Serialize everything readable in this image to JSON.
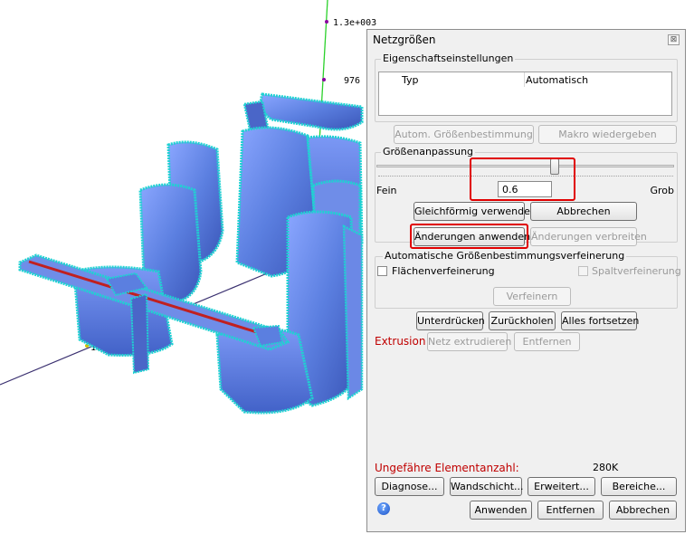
{
  "viewport": {
    "axis_labels": [
      "1.3e+003",
      "976",
      "1.2e+003"
    ]
  },
  "panel": {
    "title": "Netzgrößen",
    "close_glyph": "⊠",
    "property_settings": {
      "group_label": "Eigenschaftseinstellungen",
      "table_header_type": "Typ",
      "table_header_value": "Automatisch",
      "auto_size_button": "Autom. Größenbestimmung",
      "macro_button": "Makro wiedergeben"
    },
    "size_adjust": {
      "group_label": "Größenanpassung",
      "slider_level": 0.6,
      "label_fine": "Fein",
      "label_coarse": "Grob",
      "value": "0.6",
      "uniform_button": "Gleichförmig verwenden",
      "cancel_button": "Abbrechen",
      "apply_changes_button": "Änderungen anwenden",
      "spread_changes_button": "Änderungen verbreiten"
    },
    "auto_refine": {
      "group_label": "Automatische Größenbestimmungsverfeinerung",
      "surface_refine": "Flächenverfeinerung",
      "gap_refine": "Spaltverfeinerung",
      "refine_button": "Verfeinern"
    },
    "actions": {
      "suppress": "Unterdrücken",
      "reset": "Zurückholen",
      "continue_all": "Alles fortsetzen"
    },
    "extrusion": {
      "label": "Extrusion",
      "extrude_button": "Netz extrudieren",
      "remove_button": "Entfernen"
    },
    "element_count": {
      "label": "Ungefähre Elementanzahl:",
      "value": "280K"
    },
    "bottom_buttons": {
      "diagnose": "Diagnose...",
      "wall_layer": "Wandschicht...",
      "advanced": "Erweitert...",
      "areas": "Bereiche...",
      "apply": "Anwenden",
      "remove": "Entfernen",
      "cancel": "Abbrechen"
    },
    "help_glyph": "?",
    "colors": {
      "accent_red": "#e00000",
      "label_red": "#c00000",
      "seat_blue": "#5b7fe0",
      "mesh_cyan": "#1fd2d2"
    }
  }
}
